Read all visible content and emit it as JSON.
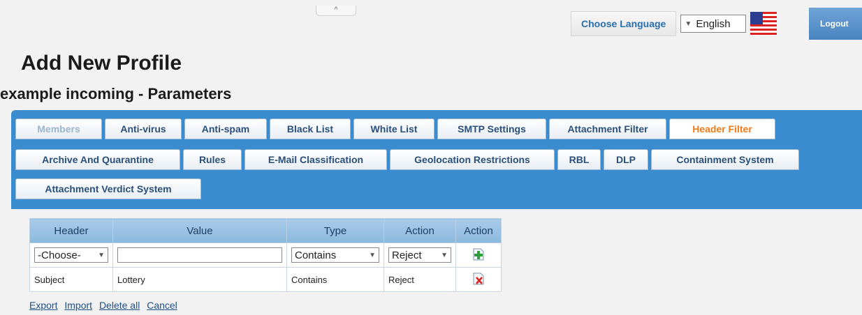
{
  "header": {
    "collapse_glyph": "^",
    "choose_language_label": "Choose Language",
    "language_value": "English",
    "logout_label": "Logout"
  },
  "page": {
    "title": "Add New Profile",
    "subtitle": "example incoming - Parameters"
  },
  "tabs": {
    "row1": [
      {
        "label": "Members",
        "state": "disabled"
      },
      {
        "label": "Anti-virus",
        "state": "normal"
      },
      {
        "label": "Anti-spam",
        "state": "normal"
      },
      {
        "label": "Black List",
        "state": "normal"
      },
      {
        "label": "White List",
        "state": "normal"
      },
      {
        "label": "SMTP Settings",
        "state": "normal"
      },
      {
        "label": "Attachment Filter",
        "state": "normal"
      },
      {
        "label": "Header Filter",
        "state": "active"
      }
    ],
    "row2": [
      {
        "label": "Archive And Quarantine",
        "state": "normal"
      },
      {
        "label": "Rules",
        "state": "normal"
      },
      {
        "label": "E-Mail Classification",
        "state": "normal"
      },
      {
        "label": "Geolocation Restrictions",
        "state": "normal"
      },
      {
        "label": "RBL",
        "state": "normal"
      },
      {
        "label": "DLP",
        "state": "normal"
      },
      {
        "label": "Containment System",
        "state": "normal"
      }
    ],
    "row3": [
      {
        "label": "Attachment Verdict System",
        "state": "normal"
      }
    ]
  },
  "table": {
    "headers": [
      "Header",
      "Value",
      "Type",
      "Action",
      "Action"
    ],
    "new_row": {
      "header_select": "-Choose-",
      "value_input": "",
      "type_select": "Contains",
      "action_select": "Reject",
      "add_icon": "add-icon"
    },
    "rows": [
      {
        "header": "Subject",
        "value": "Lottery",
        "type": "Contains",
        "action": "Reject",
        "delete_icon": "delete-icon"
      }
    ]
  },
  "links": {
    "export": "Export",
    "import": "Import",
    "delete_all": "Delete all",
    "cancel": "Cancel"
  },
  "colors": {
    "tab_panel": "#3b8ccf",
    "active_tab_text": "#f07a18",
    "link": "#1f4f8a"
  }
}
